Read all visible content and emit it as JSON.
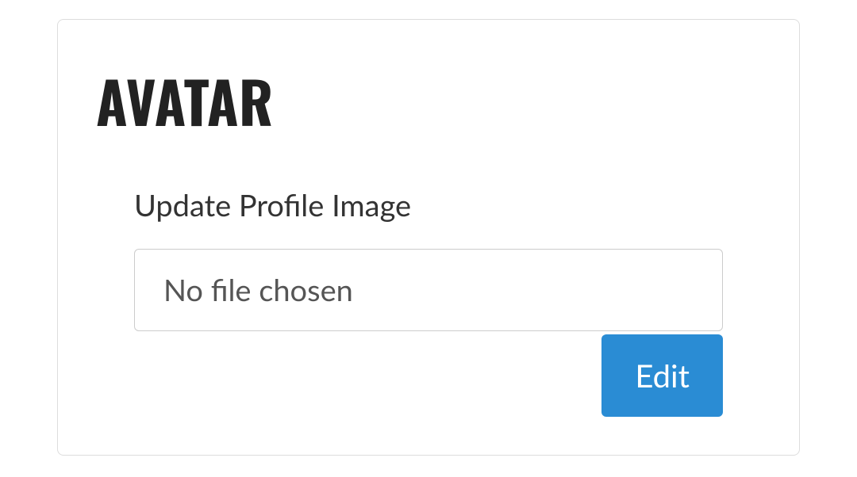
{
  "avatar": {
    "section_title": "AVATAR",
    "field_label": "Update Profile Image",
    "file_placeholder": "No file chosen",
    "edit_button_label": "Edit"
  }
}
